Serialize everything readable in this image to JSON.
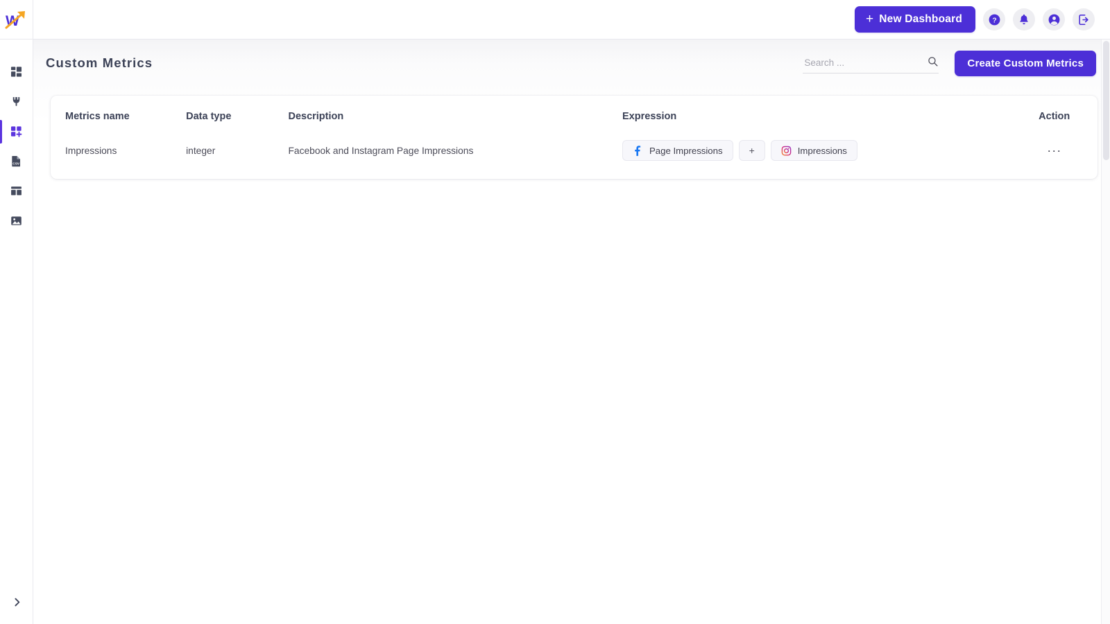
{
  "app": {
    "logo_name": "w-arrow-logo",
    "brand_accent": "#4c2fd7",
    "logo_purple": "#4c2fd7",
    "logo_orange": "#f7a torch"
  },
  "topbar": {
    "new_dashboard_label": "New Dashboard",
    "new_dashboard_plus": "+",
    "icons": [
      {
        "name": "help-icon",
        "title": "Help"
      },
      {
        "name": "notifications-bell-icon",
        "title": "Notifications"
      },
      {
        "name": "account-circle-icon",
        "title": "Account"
      },
      {
        "name": "logout-icon",
        "title": "Logout"
      }
    ]
  },
  "sidebar": {
    "items": [
      {
        "name": "sidebar-item-dashboards",
        "icon": "dashboard-grid-icon",
        "active": false
      },
      {
        "name": "sidebar-item-connections",
        "icon": "plug-icon",
        "active": false
      },
      {
        "name": "sidebar-item-custom-metrics",
        "icon": "grid-plus-icon",
        "active": true
      },
      {
        "name": "sidebar-item-csv",
        "icon": "csv-file-icon",
        "active": false
      },
      {
        "name": "sidebar-item-templates",
        "icon": "layout-template-icon",
        "active": false
      },
      {
        "name": "sidebar-item-media",
        "icon": "image-icon",
        "active": false
      }
    ],
    "expand_icon": "chevron-right-icon"
  },
  "header": {
    "title": "Custom Metrics",
    "create_button_label": "Create Custom Metrics"
  },
  "search": {
    "value": "",
    "placeholder": "Search ...",
    "icon": "search-icon"
  },
  "table": {
    "columns": [
      "Metrics name",
      "Data type",
      "Description",
      "Expression",
      "Action"
    ],
    "rows": [
      {
        "name": "Impressions",
        "data_type": "integer",
        "description": "Facebook and Instagram Page Impressions",
        "expression": [
          {
            "kind": "metric",
            "icon": "facebook-icon",
            "label": "Page Impressions"
          },
          {
            "kind": "operator",
            "icon": null,
            "label": "+"
          },
          {
            "kind": "metric",
            "icon": "instagram-icon",
            "label": "Impressions"
          }
        ],
        "action_label": "···"
      }
    ]
  },
  "colors": {
    "primary": "#4c2fd7",
    "facebook_blue": "#1877f2",
    "instagram_pink": "#d62976",
    "instagram_orange": "#f58529",
    "instagram_purple": "#962fbf",
    "text_dark": "#3c4257",
    "text_body": "#4b4b58",
    "chip_bg": "#f7f7fb",
    "rail_icon": "#454b5e"
  }
}
